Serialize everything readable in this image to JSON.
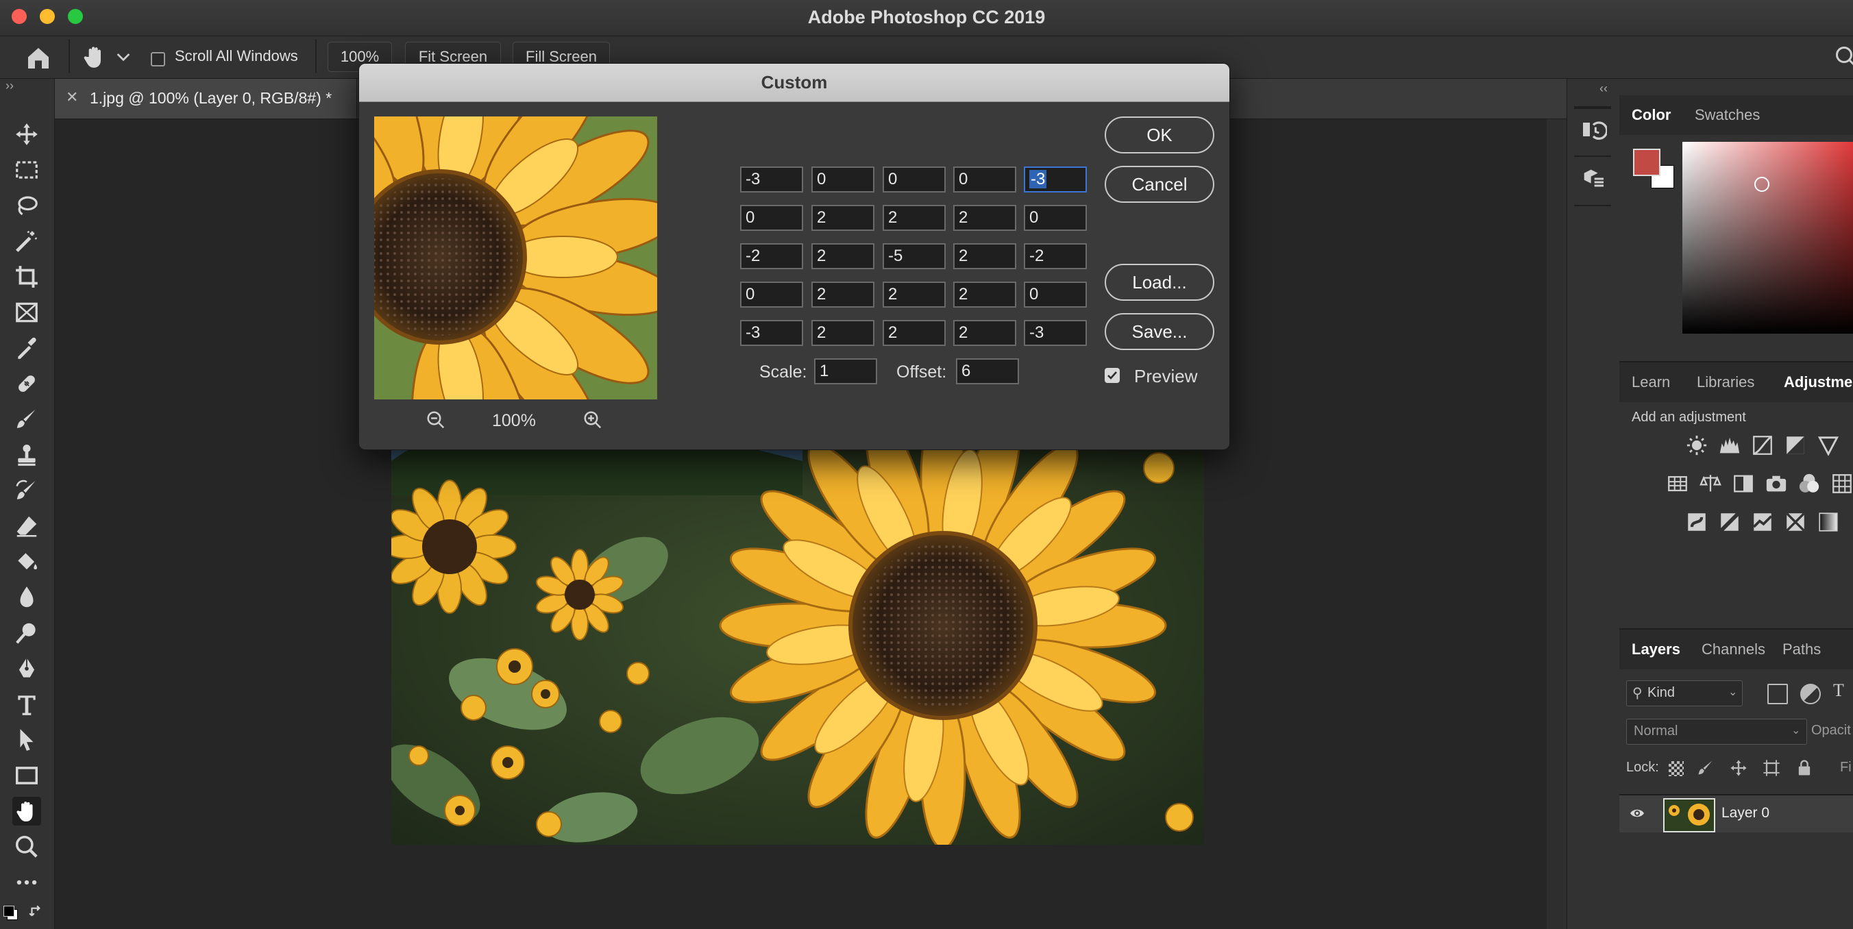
{
  "app": {
    "title": "Adobe Photoshop CC 2019"
  },
  "options_bar": {
    "scroll_all_windows": "Scroll All Windows",
    "zoom": "100%",
    "fit_screen": "Fit Screen",
    "fill_screen": "Fill Screen"
  },
  "document": {
    "tab_title": "1.jpg @ 100% (Layer 0, RGB/8#) *"
  },
  "dialog": {
    "title": "Custom",
    "matrix": [
      [
        "-3",
        "0",
        "0",
        "0",
        "-3"
      ],
      [
        "0",
        "2",
        "2",
        "2",
        "0"
      ],
      [
        "-2",
        "2",
        "-5",
        "2",
        "-2"
      ],
      [
        "0",
        "2",
        "2",
        "2",
        "0"
      ],
      [
        "-3",
        "2",
        "2",
        "2",
        "-3"
      ]
    ],
    "scale_label": "Scale:",
    "scale_value": "1",
    "offset_label": "Offset:",
    "offset_value": "6",
    "ok": "OK",
    "cancel": "Cancel",
    "load": "Load...",
    "save": "Save...",
    "preview_label": "Preview",
    "preview_checked": true,
    "zoom": "100%"
  },
  "panels": {
    "color_tabs": [
      "Color",
      "Swatches"
    ],
    "foreground_color": "#c24a44",
    "learn_tabs": [
      "Learn",
      "Libraries",
      "Adjustme"
    ],
    "add_adjustment": "Add an adjustment",
    "layers_tabs": [
      "Layers",
      "Channels",
      "Paths"
    ],
    "kind_filter": "Kind",
    "blend_mode": "Normal",
    "opacity_label": "Opacit",
    "lock_label": "Lock:",
    "fill_label": "Fi",
    "layer_name": "Layer 0"
  }
}
